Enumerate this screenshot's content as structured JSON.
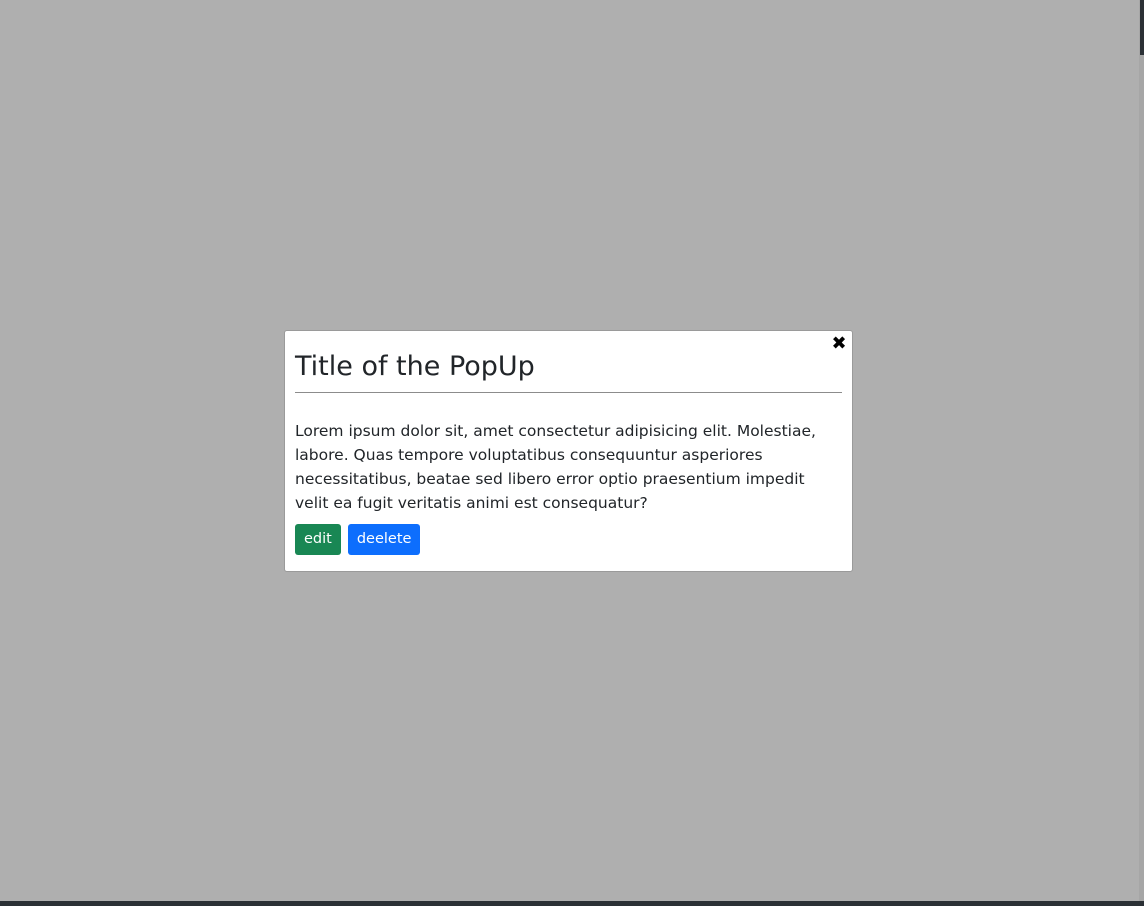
{
  "modal": {
    "close_icon": "✖",
    "title": "Title of the PopUp",
    "body": "Lorem ipsum dolor sit, amet consectetur adipisicing elit. Molestiae, labore. Quas tempore voluptatibus consequuntur asperiores necessitatibus, beatae sed libero error optio praesentium impedit velit ea fugit veritatis animi est consequatur?",
    "buttons": {
      "edit_label": "edit",
      "delete_label": "deelete"
    }
  },
  "colors": {
    "overlay": "#afafaf",
    "edit_button": "#198754",
    "delete_button": "#0d6efd",
    "dark_frame": "#2b3035"
  },
  "icons": {
    "close": "close-icon"
  }
}
